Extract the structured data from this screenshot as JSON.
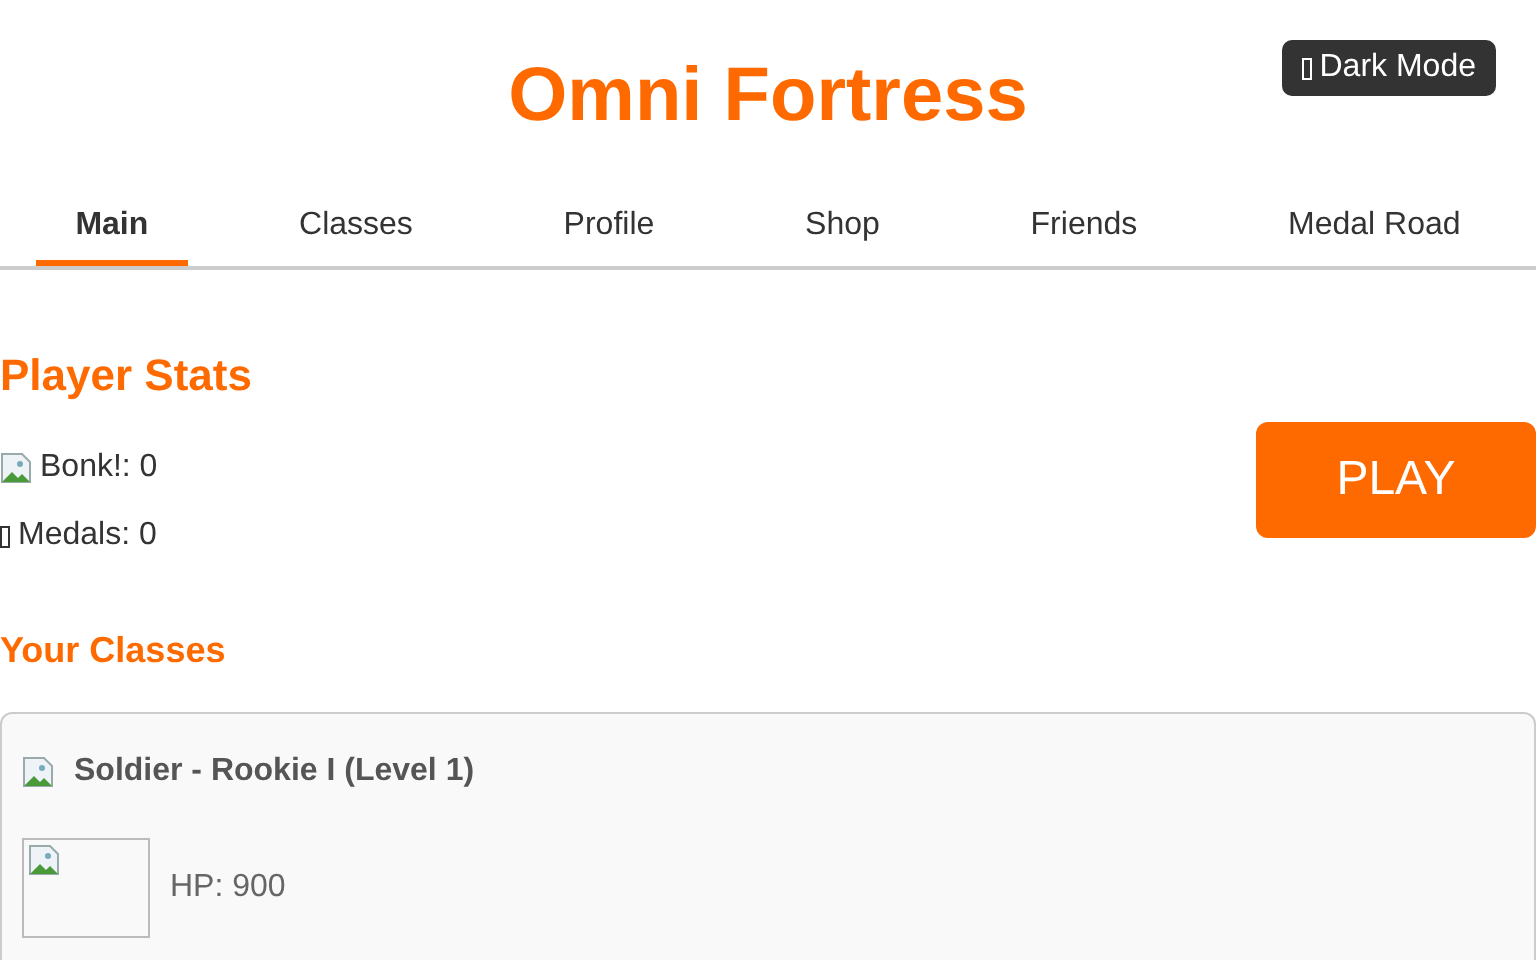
{
  "header": {
    "title": "Omni Fortress",
    "theme_button": "Dark Mode"
  },
  "tabs": [
    {
      "label": "Main",
      "selected": true
    },
    {
      "label": "Classes",
      "selected": false
    },
    {
      "label": "Profile",
      "selected": false
    },
    {
      "label": "Shop",
      "selected": false
    },
    {
      "label": "Friends",
      "selected": false
    },
    {
      "label": "Medal Road",
      "selected": false
    }
  ],
  "player_stats": {
    "heading": "Player Stats",
    "stats": [
      {
        "kind": "image",
        "text": "Bonk!: 0"
      },
      {
        "kind": "glyph",
        "text": "Medals: 0"
      }
    ],
    "play_button": "PLAY"
  },
  "your_classes": {
    "heading": "Your Classes",
    "classes": [
      {
        "title": "Soldier - Rookie I (Level 1)",
        "stats": [
          "HP: 900"
        ]
      }
    ]
  }
}
